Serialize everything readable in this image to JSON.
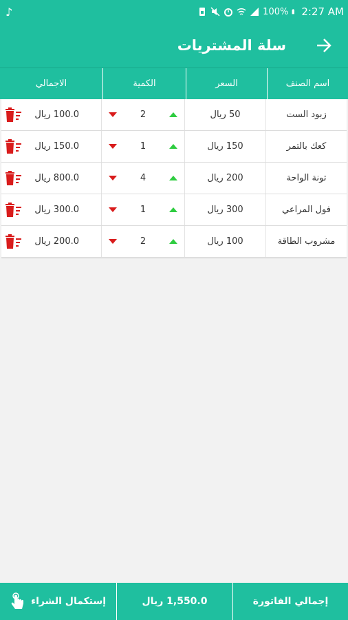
{
  "status_bar": {
    "time": "2:27 AM",
    "battery": "100%",
    "icons": [
      "music-note-icon",
      "sim-icon",
      "mute-icon",
      "alarm-icon",
      "wifi-icon",
      "signal-icon",
      "battery-icon"
    ]
  },
  "app_bar": {
    "title": "سلة المشتريات",
    "back_icon": "arrow-right-icon"
  },
  "table": {
    "headers": {
      "name": "اسم الصنف",
      "price": "السعر",
      "quantity": "الكمية",
      "total": "الاجمالي"
    },
    "rows": [
      {
        "name": "زبود الست",
        "price": "50 ريال",
        "quantity": "2",
        "total": "100.0 ريال"
      },
      {
        "name": "كعك بالتمر",
        "price": "150 ريال",
        "quantity": "1",
        "total": "150.0 ريال"
      },
      {
        "name": "تونة الواحة",
        "price": "200 ريال",
        "quantity": "4",
        "total": "800.0 ريال"
      },
      {
        "name": "فول المراعي",
        "price": "300 ريال",
        "quantity": "1",
        "total": "300.0 ريال"
      },
      {
        "name": "مشروب الطاقة",
        "price": "100 ريال",
        "quantity": "2",
        "total": "200.0 ريال"
      }
    ]
  },
  "footer": {
    "invoice_label": "إجمالي الفاتورة",
    "invoice_total": "1,550.0 ريال",
    "checkout_label": "إستكمال الشراء"
  },
  "colors": {
    "primary": "#1fbf9f",
    "increase": "#2ecc40",
    "decrease": "#d91c1c",
    "delete": "#d91c1c"
  }
}
